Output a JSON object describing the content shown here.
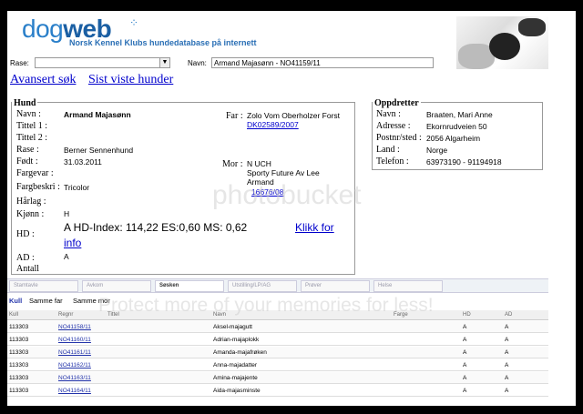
{
  "header": {
    "logo_light": "dog",
    "logo_bold": "web",
    "tagline": "Norsk Kennel Klubs hundedatabase på internett"
  },
  "search": {
    "rase_label": "Rase:",
    "rase_value": "",
    "navn_label": "Navn:",
    "navn_value": "Armand Majasønn - NO41159/11"
  },
  "links": {
    "advanced": "Avansert søk",
    "recent": "Sist viste hunder"
  },
  "hund": {
    "title": "Hund",
    "fields": {
      "navn_label": "Navn :",
      "navn": "Armand Majasønn",
      "tittel1_label": "Tittel 1 :",
      "tittel2_label": "Tittel 2 :",
      "rase_label": "Rase :",
      "rase": "Berner Sennenhund",
      "fodt_label": "Født :",
      "fodt": "31.03.2011",
      "fargevar_label": "Fargevar :",
      "fargebeskr_label": "Fargbeskri :",
      "fargebeskr": "Tricolor",
      "harlag_label": "Hårlag :",
      "kjonn_label": "Kjønn :",
      "kjonn": "H",
      "hd_label": "HD :",
      "hd_text": "A   HD-Index: 114,22  ES:0,60  MS: 0,62",
      "hd_link": "Klikk for info",
      "ad_label": "AD :",
      "ad": "A",
      "antall_label": "Antall"
    },
    "far_label": "Far :",
    "far_name": "Zolo Vom Oberholzer Forst",
    "far_reg": "DK02589/2007",
    "mor_label": "Mor :",
    "mor_title": "N UCH",
    "mor_name_1": "Sporty Future Av Lee",
    "mor_name_2": "Armand",
    "mor_reg": "16676/08"
  },
  "oppdretter": {
    "title": "Oppdretter",
    "navn_label": "Navn :",
    "navn": "Braaten, Mari Anne",
    "adresse_label": "Adresse :",
    "adresse": "Ekornrudveien 50",
    "postnr_label": "Postnr/sted :",
    "postnr": "2056 Algarheim",
    "land_label": "Land :",
    "land": "Norge",
    "telefon_label": "Telefon :",
    "telefon": "63973190 - 91194918"
  },
  "tabs": [
    "Stamtavle",
    "Avkom",
    "Søsken",
    "Utstilling/LP/AG",
    "Prøver",
    "Helse"
  ],
  "subtabs": [
    "Kull",
    "Samme far",
    "Samme mor"
  ],
  "table": {
    "headers": [
      "Kull",
      "Regnr",
      "Tittel",
      "Navn",
      "Farge",
      "HD",
      "AD"
    ],
    "rows": [
      {
        "kull": "113303",
        "regnr": "NO41158/11",
        "navn": "Aksel-majagutt",
        "hd": "A",
        "ad": "A"
      },
      {
        "kull": "113303",
        "regnr": "NO41160/11",
        "navn": "Adrian-majaplokk",
        "hd": "A",
        "ad": "A"
      },
      {
        "kull": "113303",
        "regnr": "NO41161/11",
        "navn": "Amanda-majafrøken",
        "hd": "A",
        "ad": "A"
      },
      {
        "kull": "113303",
        "regnr": "NO41162/11",
        "navn": "Anna-majadatter",
        "hd": "A",
        "ad": "A"
      },
      {
        "kull": "113303",
        "regnr": "NO41163/11",
        "navn": "Amina-majajente",
        "hd": "A",
        "ad": "A"
      },
      {
        "kull": "113303",
        "regnr": "NO41164/11",
        "navn": "Aida-majasminste",
        "hd": "A",
        "ad": "A"
      }
    ]
  },
  "watermark": {
    "line1": "photobucket",
    "line2": "Protect more of your memories for less!"
  }
}
